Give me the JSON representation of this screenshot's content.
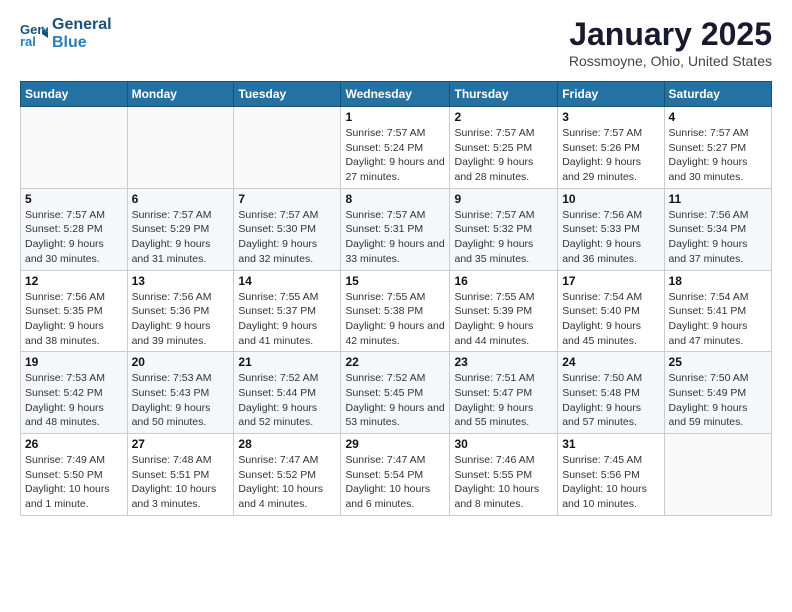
{
  "header": {
    "logo_line1": "General",
    "logo_line2": "Blue",
    "title": "January 2025",
    "subtitle": "Rossmoyne, Ohio, United States"
  },
  "weekdays": [
    "Sunday",
    "Monday",
    "Tuesday",
    "Wednesday",
    "Thursday",
    "Friday",
    "Saturday"
  ],
  "weeks": [
    [
      {
        "day": "",
        "info": ""
      },
      {
        "day": "",
        "info": ""
      },
      {
        "day": "",
        "info": ""
      },
      {
        "day": "1",
        "info": "Sunrise: 7:57 AM\nSunset: 5:24 PM\nDaylight: 9 hours and 27 minutes."
      },
      {
        "day": "2",
        "info": "Sunrise: 7:57 AM\nSunset: 5:25 PM\nDaylight: 9 hours and 28 minutes."
      },
      {
        "day": "3",
        "info": "Sunrise: 7:57 AM\nSunset: 5:26 PM\nDaylight: 9 hours and 29 minutes."
      },
      {
        "day": "4",
        "info": "Sunrise: 7:57 AM\nSunset: 5:27 PM\nDaylight: 9 hours and 30 minutes."
      }
    ],
    [
      {
        "day": "5",
        "info": "Sunrise: 7:57 AM\nSunset: 5:28 PM\nDaylight: 9 hours and 30 minutes."
      },
      {
        "day": "6",
        "info": "Sunrise: 7:57 AM\nSunset: 5:29 PM\nDaylight: 9 hours and 31 minutes."
      },
      {
        "day": "7",
        "info": "Sunrise: 7:57 AM\nSunset: 5:30 PM\nDaylight: 9 hours and 32 minutes."
      },
      {
        "day": "8",
        "info": "Sunrise: 7:57 AM\nSunset: 5:31 PM\nDaylight: 9 hours and 33 minutes."
      },
      {
        "day": "9",
        "info": "Sunrise: 7:57 AM\nSunset: 5:32 PM\nDaylight: 9 hours and 35 minutes."
      },
      {
        "day": "10",
        "info": "Sunrise: 7:56 AM\nSunset: 5:33 PM\nDaylight: 9 hours and 36 minutes."
      },
      {
        "day": "11",
        "info": "Sunrise: 7:56 AM\nSunset: 5:34 PM\nDaylight: 9 hours and 37 minutes."
      }
    ],
    [
      {
        "day": "12",
        "info": "Sunrise: 7:56 AM\nSunset: 5:35 PM\nDaylight: 9 hours and 38 minutes."
      },
      {
        "day": "13",
        "info": "Sunrise: 7:56 AM\nSunset: 5:36 PM\nDaylight: 9 hours and 39 minutes."
      },
      {
        "day": "14",
        "info": "Sunrise: 7:55 AM\nSunset: 5:37 PM\nDaylight: 9 hours and 41 minutes."
      },
      {
        "day": "15",
        "info": "Sunrise: 7:55 AM\nSunset: 5:38 PM\nDaylight: 9 hours and 42 minutes."
      },
      {
        "day": "16",
        "info": "Sunrise: 7:55 AM\nSunset: 5:39 PM\nDaylight: 9 hours and 44 minutes."
      },
      {
        "day": "17",
        "info": "Sunrise: 7:54 AM\nSunset: 5:40 PM\nDaylight: 9 hours and 45 minutes."
      },
      {
        "day": "18",
        "info": "Sunrise: 7:54 AM\nSunset: 5:41 PM\nDaylight: 9 hours and 47 minutes."
      }
    ],
    [
      {
        "day": "19",
        "info": "Sunrise: 7:53 AM\nSunset: 5:42 PM\nDaylight: 9 hours and 48 minutes."
      },
      {
        "day": "20",
        "info": "Sunrise: 7:53 AM\nSunset: 5:43 PM\nDaylight: 9 hours and 50 minutes."
      },
      {
        "day": "21",
        "info": "Sunrise: 7:52 AM\nSunset: 5:44 PM\nDaylight: 9 hours and 52 minutes."
      },
      {
        "day": "22",
        "info": "Sunrise: 7:52 AM\nSunset: 5:45 PM\nDaylight: 9 hours and 53 minutes."
      },
      {
        "day": "23",
        "info": "Sunrise: 7:51 AM\nSunset: 5:47 PM\nDaylight: 9 hours and 55 minutes."
      },
      {
        "day": "24",
        "info": "Sunrise: 7:50 AM\nSunset: 5:48 PM\nDaylight: 9 hours and 57 minutes."
      },
      {
        "day": "25",
        "info": "Sunrise: 7:50 AM\nSunset: 5:49 PM\nDaylight: 9 hours and 59 minutes."
      }
    ],
    [
      {
        "day": "26",
        "info": "Sunrise: 7:49 AM\nSunset: 5:50 PM\nDaylight: 10 hours and 1 minute."
      },
      {
        "day": "27",
        "info": "Sunrise: 7:48 AM\nSunset: 5:51 PM\nDaylight: 10 hours and 3 minutes."
      },
      {
        "day": "28",
        "info": "Sunrise: 7:47 AM\nSunset: 5:52 PM\nDaylight: 10 hours and 4 minutes."
      },
      {
        "day": "29",
        "info": "Sunrise: 7:47 AM\nSunset: 5:54 PM\nDaylight: 10 hours and 6 minutes."
      },
      {
        "day": "30",
        "info": "Sunrise: 7:46 AM\nSunset: 5:55 PM\nDaylight: 10 hours and 8 minutes."
      },
      {
        "day": "31",
        "info": "Sunrise: 7:45 AM\nSunset: 5:56 PM\nDaylight: 10 hours and 10 minutes."
      },
      {
        "day": "",
        "info": ""
      }
    ]
  ]
}
